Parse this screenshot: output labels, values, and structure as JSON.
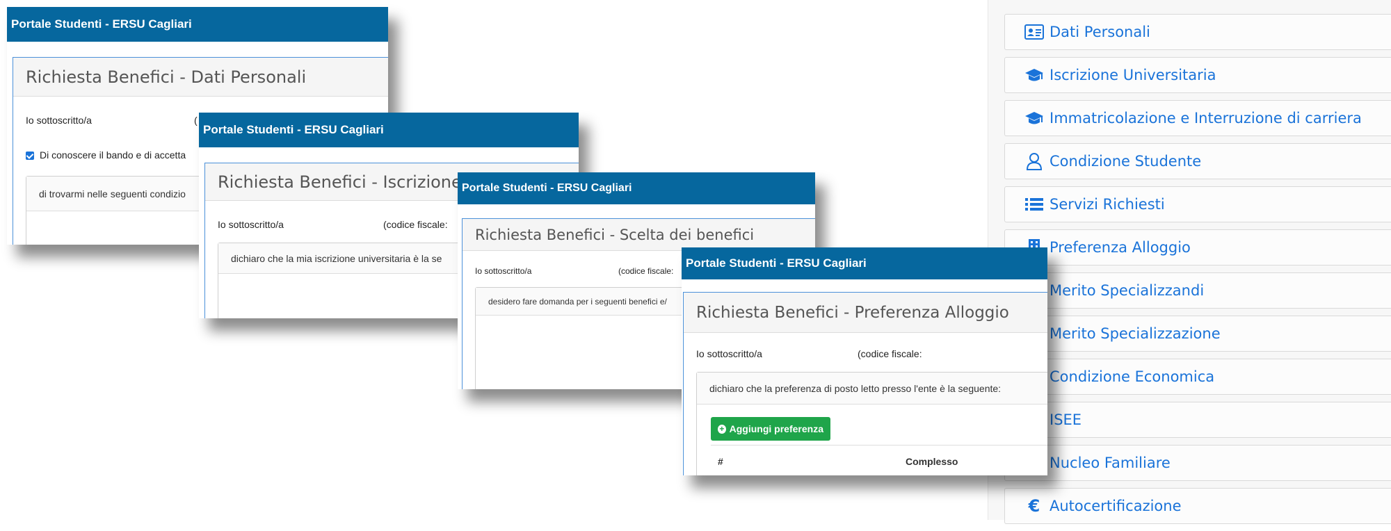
{
  "portal_title": "Portale Studenti - ERSU Cagliari",
  "windows": {
    "dati_personali": {
      "heading": "Richiesta Benefici - Dati Personali",
      "line1": "Io sottoscritto/a",
      "line1_right": "(",
      "checkbox_label": "Di conoscere il bando e di accetta",
      "box_text": "di trovarmi nelle seguenti condizio"
    },
    "iscrizione": {
      "heading": "Richiesta Benefici - Iscrizione Ur",
      "line1": "Io sottoscritto/a",
      "line1_right": "(codice fiscale:",
      "box_text": "dichiaro che la mia iscrizione universitaria è la se"
    },
    "scelta": {
      "heading": "Richiesta Benefici - Scelta dei benefici",
      "line1": "Io sottoscritto/a",
      "line1_right": "(codice fiscale:",
      "box_text": "desidero fare domanda per i seguenti benefici e/"
    },
    "alloggio": {
      "heading": "Richiesta Benefici - Preferenza Alloggio",
      "line1": "Io sottoscritto/a",
      "line1_right": "(codice fiscale:",
      "box_text": "dichiaro che la preferenza di posto letto presso l'ente è la seguente:",
      "add_button": "Aggiungi preferenza",
      "col_hash": "#",
      "col_complesso": "Complesso"
    }
  },
  "sidebar": {
    "items": [
      {
        "label": "Dati Personali",
        "icon": "id-card-icon"
      },
      {
        "label": "Iscrizione Universitaria",
        "icon": "graduation-cap-icon"
      },
      {
        "label": "Immatricolazione e Interruzione di carriera",
        "icon": "graduation-cap-icon"
      },
      {
        "label": "Condizione Studente",
        "icon": "user-icon"
      },
      {
        "label": "Servizi Richiesti",
        "icon": "list-icon"
      },
      {
        "label": "Preferenza Alloggio",
        "icon": "building-icon"
      },
      {
        "label": "Merito Specializzandi",
        "icon": ""
      },
      {
        "label": "Merito Specializzazione",
        "icon": ""
      },
      {
        "label": "Condizione Economica",
        "icon": ""
      },
      {
        "label": "ISEE",
        "icon": ""
      },
      {
        "label": "Nucleo Familiare",
        "icon": ""
      },
      {
        "label": "Autocertificazione",
        "icon": "euro-icon"
      }
    ]
  },
  "colors": {
    "titlebar": "#06679e",
    "link": "#1a73d9",
    "green": "#1fa54a"
  }
}
